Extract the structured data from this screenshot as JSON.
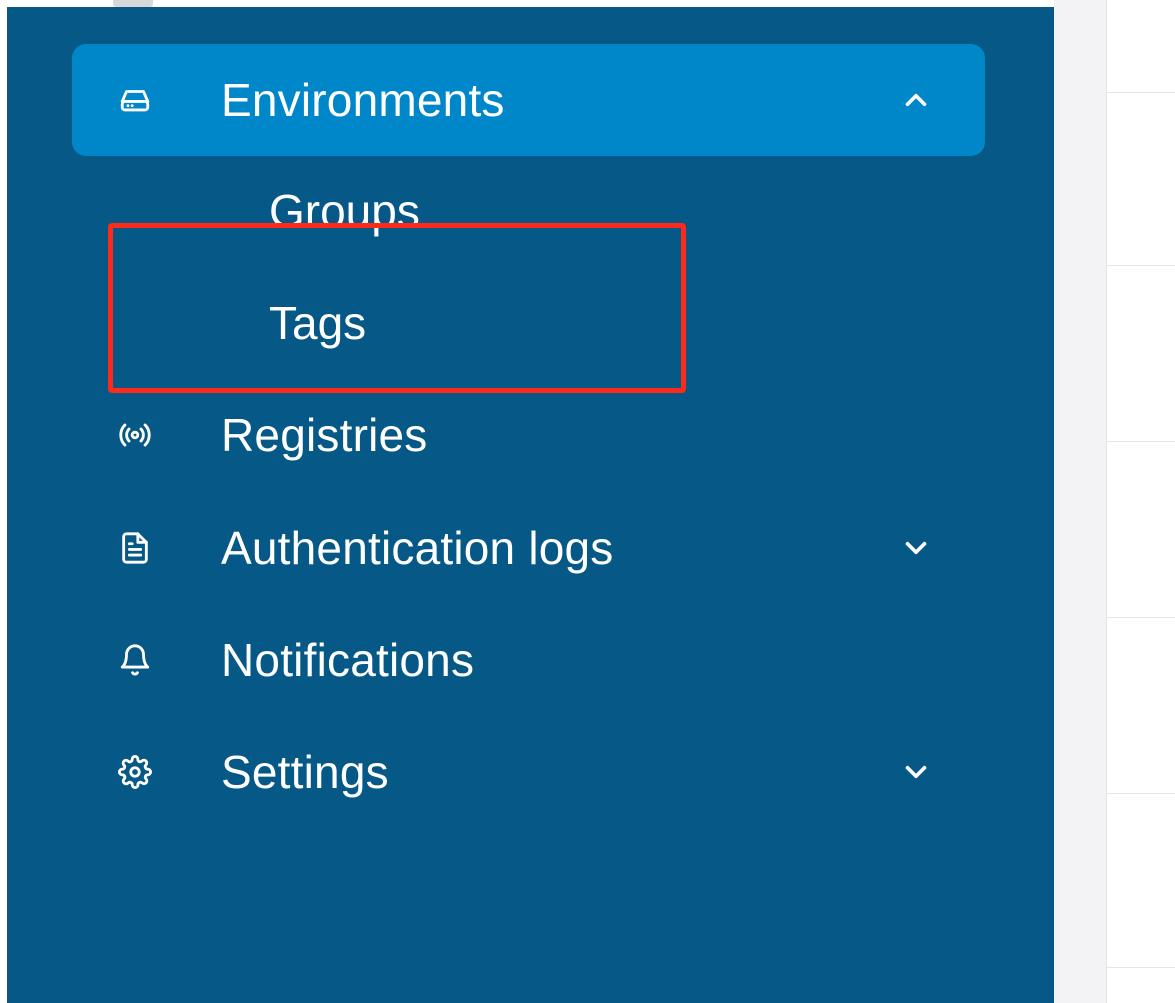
{
  "colors": {
    "sidebar_bg": "#065887",
    "active_bg": "#0087ca",
    "text": "#ffffff",
    "highlight": "#ff2a1a"
  },
  "sidebar": {
    "items": [
      {
        "label": "Environments",
        "icon": "hard-drive-icon",
        "expanded": true,
        "active": true
      },
      {
        "label": "Registries",
        "icon": "broadcast-icon"
      },
      {
        "label": "Authentication logs",
        "icon": "file-text-icon",
        "expandable": true
      },
      {
        "label": "Notifications",
        "icon": "bell-icon"
      },
      {
        "label": "Settings",
        "icon": "gear-icon",
        "expandable": true
      }
    ],
    "environments_children": [
      {
        "label": "Groups"
      },
      {
        "label": "Tags"
      }
    ]
  },
  "highlight": {
    "target": "Tags"
  }
}
